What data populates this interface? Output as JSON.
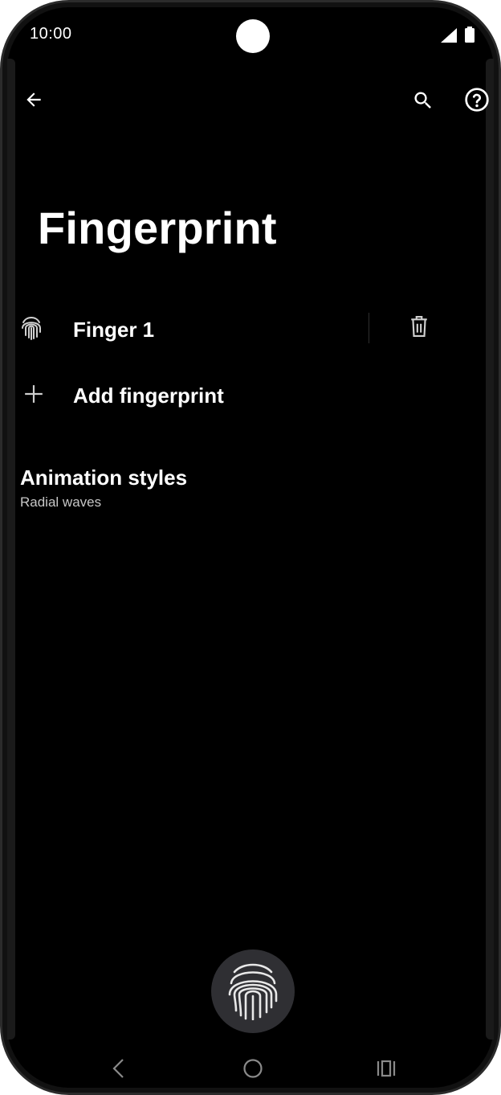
{
  "status_bar": {
    "time": "10:00",
    "icons": [
      "signal-icon",
      "battery-icon"
    ]
  },
  "app_bar": {
    "back_icon": "arrow-left-icon",
    "search_icon": "search-icon",
    "help_icon": "help-icon"
  },
  "page": {
    "title": "Fingerprint"
  },
  "fingerprints": [
    {
      "label": "Finger 1",
      "icon": "fingerprint-icon",
      "action_icon": "trash-icon"
    }
  ],
  "add_fingerprint": {
    "label": "Add fingerprint",
    "icon": "plus-icon"
  },
  "animation": {
    "title": "Animation styles",
    "value": "Radial waves"
  },
  "colors": {
    "background": "#000000",
    "text": "#ffffff",
    "subtext": "#c7c7c7",
    "sensor_bg": "#2f2f33"
  },
  "nav_bar": {
    "icons": [
      "back-nav-icon",
      "home-nav-icon",
      "recents-nav-icon"
    ]
  }
}
